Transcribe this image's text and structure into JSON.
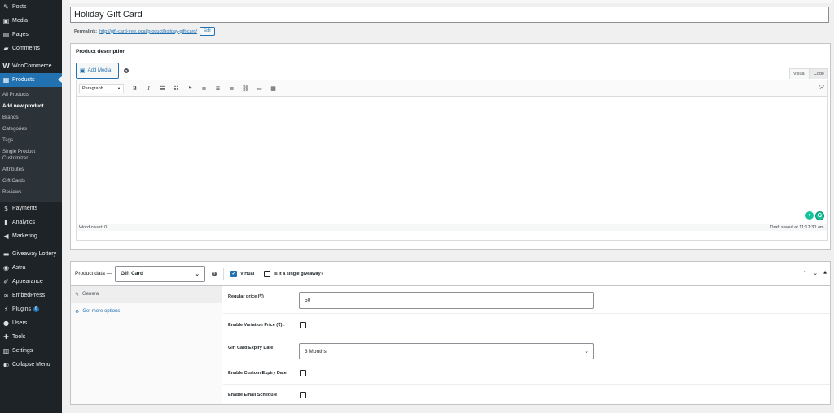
{
  "sidebar": {
    "top_items": [
      {
        "label": "Posts",
        "icon": "pin-icon"
      },
      {
        "label": "Media",
        "icon": "media-icon"
      },
      {
        "label": "Pages",
        "icon": "pages-icon"
      },
      {
        "label": "Comments",
        "icon": "comments-icon"
      }
    ],
    "woocommerce": {
      "label": "WooCommerce",
      "icon": "woocommerce-icon"
    },
    "products": {
      "label": "Products",
      "icon": "products-icon"
    },
    "submenu": [
      "All Products",
      "Add new product",
      "Brands",
      "Categories",
      "Tags",
      "Single Product Customizer",
      "Attributes",
      "Gift Cards",
      "Reviews"
    ],
    "lower_items": [
      {
        "label": "Payments",
        "icon": "payments-icon"
      },
      {
        "label": "Analytics",
        "icon": "analytics-icon"
      },
      {
        "label": "Marketing",
        "icon": "marketing-icon"
      }
    ],
    "bottom_items": [
      {
        "label": "Giveaway Lottery",
        "icon": "giveaway-icon"
      },
      {
        "label": "Astra",
        "icon": "astra-icon"
      },
      {
        "label": "Appearance",
        "icon": "appearance-icon"
      },
      {
        "label": "EmbedPress",
        "icon": "embedpress-icon"
      },
      {
        "label": "Plugins",
        "icon": "plugins-icon",
        "badge": "6"
      },
      {
        "label": "Users",
        "icon": "users-icon"
      },
      {
        "label": "Tools",
        "icon": "tools-icon"
      },
      {
        "label": "Settings",
        "icon": "settings-icon"
      },
      {
        "label": "Collapse Menu",
        "icon": "collapse-icon"
      }
    ]
  },
  "post": {
    "title": "Holiday Gift Card",
    "permalink_label": "Permalink:",
    "permalink_url": "http://gift-card-free.local/product/holiday-gift-card/",
    "edit_label": "Edit"
  },
  "description": {
    "title": "Product description",
    "add_media": "Add Media",
    "help": "?",
    "tab_visual": "Visual",
    "tab_code": "Code",
    "format": "Paragraph",
    "word_count": "Word count: 0",
    "draft_saved": "Draft saved at 11:17:30 am."
  },
  "product_data": {
    "title": "Product data —",
    "type": "Gift Card",
    "help": "?",
    "virtual_label": "Virtual",
    "virtual_checked": true,
    "giveaway_label": "Is it a single giveaway?",
    "giveaway_checked": false,
    "nav": {
      "general": "General",
      "more": "Get more options"
    },
    "fields": {
      "regular_price_label": "Regular price (₹)",
      "regular_price_value": "50",
      "variation_label": "Enable Variation Price (₹) :",
      "expiry_label": "Gift Card Expiry Date",
      "expiry_value": "3 Months",
      "custom_expiry_label": "Enable Custom Expiry Date",
      "email_schedule_label": "Enable Email Schedule"
    }
  },
  "colors": {
    "sidebar_bg": "#1d2327",
    "accent": "#2271b1",
    "grammarly": "#15c39a"
  }
}
